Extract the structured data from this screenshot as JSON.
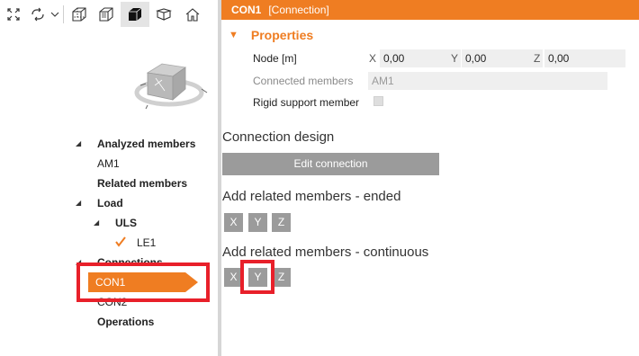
{
  "toolbar": {
    "items": [
      {
        "icon": "fit-view-icon"
      },
      {
        "icon": "rotate-view-icon"
      },
      {
        "icon": "dropdown-chevron-icon"
      },
      {
        "icon": "wireframe-cube-icon"
      },
      {
        "icon": "shaded-cube-icon"
      },
      {
        "icon": "solid-cube-icon",
        "active": true
      },
      {
        "icon": "section-view-icon"
      },
      {
        "icon": "home-icon"
      }
    ]
  },
  "tree": {
    "analyzed_members": "Analyzed members",
    "am1": "AM1",
    "related_members": "Related members",
    "load": "Load",
    "uls": "ULS",
    "le1": "LE1",
    "connections": "Connections",
    "con1": "CON1",
    "con2": "CON2",
    "operations": "Operations"
  },
  "panel": {
    "title_name": "CON1",
    "title_type": "[Connection]",
    "properties_label": "Properties",
    "node_label": "Node [m]",
    "x_label": "X",
    "x_value": "0,00",
    "y_label": "Y",
    "y_value": "0,00",
    "z_label": "Z",
    "z_value": "0,00",
    "connected_members_label": "Connected members",
    "connected_members_value": "AM1",
    "rigid_support_label": "Rigid support member",
    "connection_design_heading": "Connection design",
    "edit_connection_button": "Edit connection",
    "ended_heading": "Add related members - ended",
    "continuous_heading": "Add related members - continuous",
    "axes": [
      "X",
      "Y",
      "Z"
    ]
  },
  "colors": {
    "accent": "#ef7d22",
    "highlight": "#e8202a",
    "button_grey": "#9b9b9b",
    "field_bg": "#efefef"
  }
}
